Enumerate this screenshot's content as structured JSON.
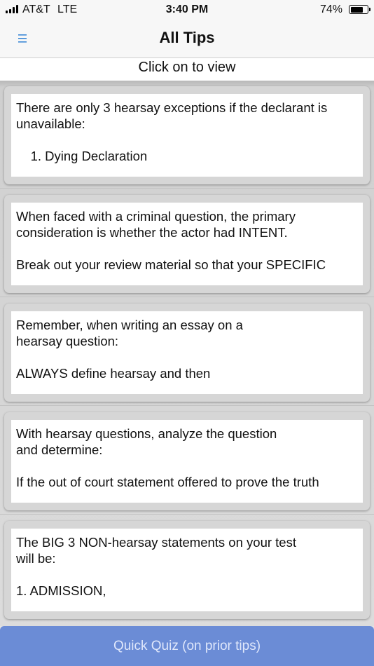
{
  "status_bar": {
    "carrier": "AT&T",
    "network": "LTE",
    "time": "3:40 PM",
    "battery_percent": "74%",
    "battery_level": 0.74
  },
  "nav": {
    "title": "All Tips",
    "menu_icon": "hamburger-menu-icon",
    "accent_color": "#3b88d6"
  },
  "subheader": {
    "text": "Click on to view"
  },
  "tips": [
    {
      "line1": "There are only 3 hearsay exceptions if the declarant is unavailable:",
      "line2": "    1. Dying Declaration"
    },
    {
      "line1": "When faced with a criminal question, the primary consideration is whether the actor had INTENT.",
      "line2": "Break out your review material so that your SPECIFIC"
    },
    {
      "line1": "Remember, when writing an essay on a\nhearsay question:",
      "line2": "ALWAYS define hearsay and then"
    },
    {
      "line1": "With hearsay questions, analyze the question\nand determine:",
      "line2": "If the out of court statement offered to prove the truth"
    },
    {
      "line1": "The BIG 3 NON-hearsay statements on your test\nwill be:",
      "line2": "1. ADMISSION,"
    }
  ],
  "quiz_button": {
    "label": "Quick Quiz (on prior tips)",
    "color": "#6b8cd6"
  }
}
